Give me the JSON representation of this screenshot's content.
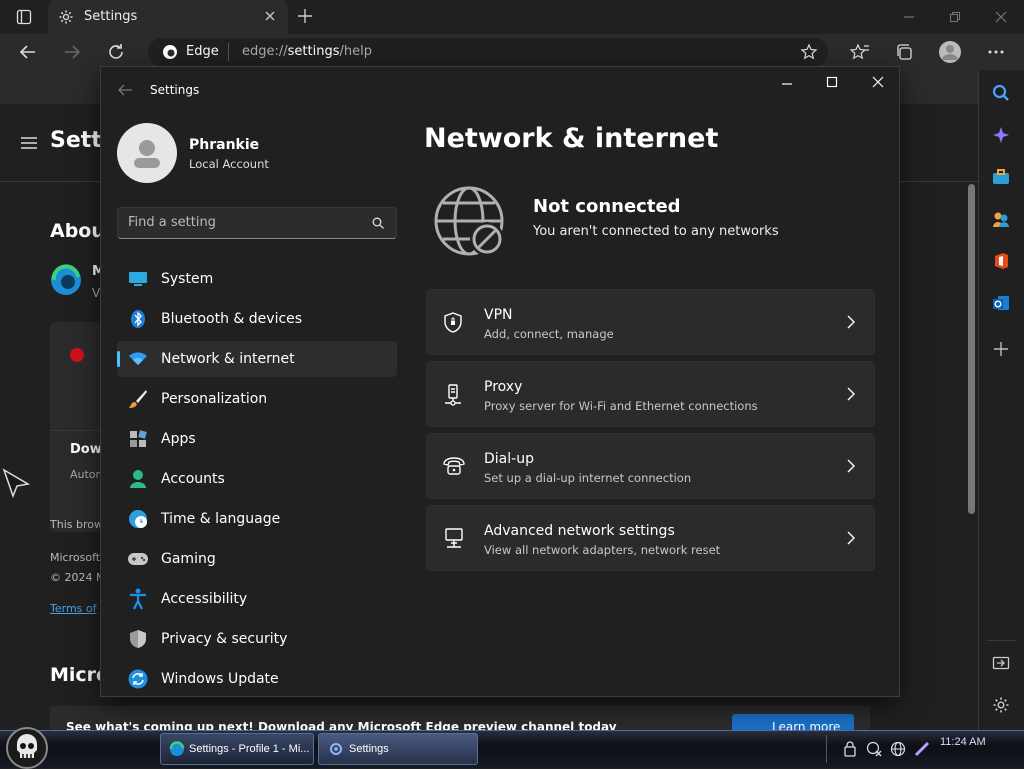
{
  "browser": {
    "tab_title": "Settings",
    "brand": "Edge",
    "url_prefix": "edge://",
    "url_bold": "settings",
    "url_suffix": "/help"
  },
  "edge_page": {
    "menu_title": "Setti",
    "about": "Abou",
    "product_initial": "M",
    "product_sub": "V",
    "download_title": "Dow",
    "download_sub": "Autom",
    "this_browser": "This brow",
    "microsoft_line": "Microsoft",
    "copyright": "© 2024 M",
    "terms_link": "Terms of",
    "micro_heading": "Micro",
    "bottom_banner": "See what's coming up next! Download any Microsoft Edge preview channel today",
    "learn_more": "Learn more"
  },
  "settings": {
    "window_title": "Settings",
    "user_name": "Phrankie",
    "user_type": "Local Account",
    "search_placeholder": "Find a setting",
    "nav": [
      {
        "label": "System",
        "icon": "monitor-icon"
      },
      {
        "label": "Bluetooth & devices",
        "icon": "bluetooth-icon"
      },
      {
        "label": "Network & internet",
        "icon": "wifi-icon",
        "active": true
      },
      {
        "label": "Personalization",
        "icon": "brush-icon"
      },
      {
        "label": "Apps",
        "icon": "apps-icon"
      },
      {
        "label": "Accounts",
        "icon": "person-icon"
      },
      {
        "label": "Time & language",
        "icon": "globe-clock-icon"
      },
      {
        "label": "Gaming",
        "icon": "gamepad-icon"
      },
      {
        "label": "Accessibility",
        "icon": "accessibility-icon"
      },
      {
        "label": "Privacy & security",
        "icon": "shield-icon"
      },
      {
        "label": "Windows Update",
        "icon": "update-icon"
      }
    ],
    "page_title": "Network & internet",
    "status_title": "Not connected",
    "status_sub": "You aren't connected to any networks",
    "cards": [
      {
        "title": "VPN",
        "sub": "Add, connect, manage",
        "icon": "vpn-shield-icon"
      },
      {
        "title": "Proxy",
        "sub": "Proxy server for Wi-Fi and Ethernet connections",
        "icon": "proxy-icon"
      },
      {
        "title": "Dial-up",
        "sub": "Set up a dial-up internet connection",
        "icon": "dialup-icon"
      },
      {
        "title": "Advanced network settings",
        "sub": "View all network adapters, network reset",
        "icon": "advanced-network-icon"
      }
    ],
    "accent_color": "#4cc2ff"
  },
  "taskbar": {
    "tasks": [
      {
        "label": "Settings - Profile 1 - Mi...",
        "icon": "edge-icon"
      },
      {
        "label": "Settings",
        "icon": "settings-gear-icon"
      }
    ],
    "time": "11:24 AM"
  }
}
